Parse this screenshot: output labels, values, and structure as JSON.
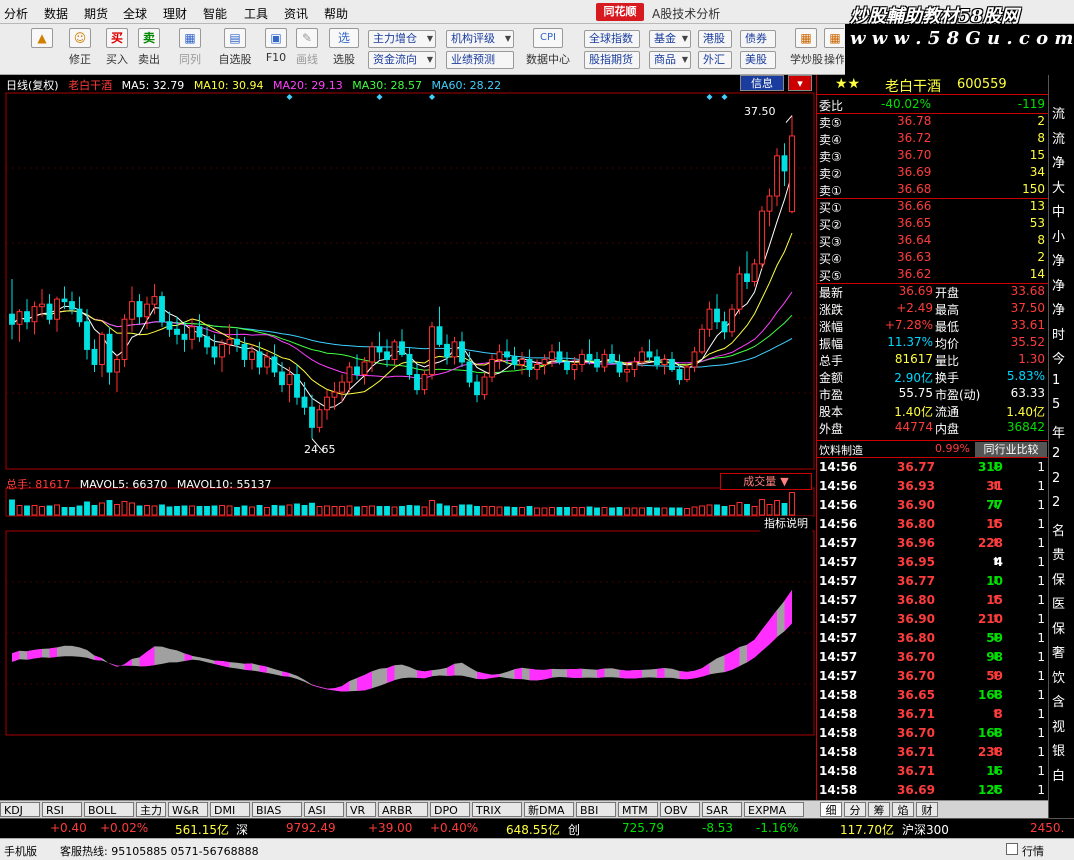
{
  "menu": [
    "分析",
    "数据",
    "期货",
    "全球",
    "理财",
    "智能",
    "工具",
    "资讯",
    "帮助"
  ],
  "brand": "同花顺",
  "app_title": "A股技术分析",
  "watermark": {
    "title": "炒股輔助教材58股网",
    "url": "w w w . 5 8 G u . c o m"
  },
  "toolbar": {
    "buttons": [
      {
        "label": "",
        "icon": "up-arrow-icon"
      },
      {
        "label": "修正",
        "icon": "face-icon"
      },
      {
        "label": "买入",
        "icon": "buy-icon"
      },
      {
        "label": "卖出",
        "icon": "sell-icon"
      },
      {
        "label": "同列",
        "icon": "columns-icon"
      },
      {
        "label": "自选股",
        "icon": "watchlist-icon"
      },
      {
        "label": "F10",
        "icon": "f10-icon"
      },
      {
        "label": "画线",
        "icon": "draw-line-icon"
      },
      {
        "label": "选股",
        "icon": "select-stock-icon"
      },
      {
        "label": "数据中心",
        "icon": "data-center-icon"
      },
      {
        "label": "学炒股",
        "icon": "learn-icon"
      },
      {
        "label": "操作分",
        "icon": "ops-icon"
      }
    ],
    "icon_text": {
      "buy": "买",
      "sell": "卖",
      "select": "选",
      "cpi": "CPI"
    },
    "pills": [
      "主力增仓",
      "资金流向",
      "机构评级",
      "业绩预测",
      "全球指数",
      "股指期货",
      "基金",
      "商品",
      "港股",
      "外汇",
      "债券",
      "美股"
    ]
  },
  "chart": {
    "period_label": "日线(复权)",
    "stock_name": "老白干酒",
    "ma": [
      {
        "label": "MA5: 32.79",
        "color": "#ffffff"
      },
      {
        "label": "MA10: 30.94",
        "color": "#ffff40"
      },
      {
        "label": "MA20: 29.13",
        "color": "#ff40ff"
      },
      {
        "label": "MA30: 28.57",
        "color": "#40ff40"
      },
      {
        "label": "MA60: 28.22",
        "color": "#40d0ff"
      }
    ],
    "high_label": "37.50",
    "low_label": "24.65",
    "info_btn": "信息",
    "vol_line": {
      "total_label": "总手:",
      "total": "81617",
      "mavol5": "MAVOL5: 66370",
      "mavol10": "MAVOL10: 55137"
    },
    "vol_btn": "成交量",
    "indicator_btn": "指标说明",
    "indicator_tabs": [
      "KDJ",
      "RSI",
      "BOLL",
      "主力",
      "W&R",
      "DMI",
      "BIAS",
      "ASI",
      "VR",
      "ARBR",
      "DPO",
      "TRIX",
      "新DMA",
      "BBI",
      "MTM",
      "OBV",
      "SAR",
      "EXPMA"
    ]
  },
  "quote": {
    "name": "老白干酒",
    "code": "600559",
    "weibi": {
      "label": "委比",
      "pct": "-40.02%",
      "diff": "-119"
    },
    "asks": [
      {
        "label": "卖⑤",
        "price": "36.78",
        "vol": "2"
      },
      {
        "label": "卖④",
        "price": "36.72",
        "vol": "8"
      },
      {
        "label": "卖③",
        "price": "36.70",
        "vol": "15"
      },
      {
        "label": "卖②",
        "price": "36.69",
        "vol": "34"
      },
      {
        "label": "卖①",
        "price": "36.68",
        "vol": "150"
      }
    ],
    "bids": [
      {
        "label": "买①",
        "price": "36.66",
        "vol": "13"
      },
      {
        "label": "买②",
        "price": "36.65",
        "vol": "53"
      },
      {
        "label": "买③",
        "price": "36.64",
        "vol": "8"
      },
      {
        "label": "买④",
        "price": "36.63",
        "vol": "2"
      },
      {
        "label": "买⑤",
        "price": "36.62",
        "vol": "14"
      }
    ],
    "stats": [
      {
        "l1": "最新",
        "v1": "36.69",
        "c1": "red",
        "l2": "开盘",
        "v2": "33.68",
        "c2": "red"
      },
      {
        "l1": "涨跌",
        "v1": "+2.49",
        "c1": "red",
        "l2": "最高",
        "v2": "37.50",
        "c2": "red"
      },
      {
        "l1": "涨幅",
        "v1": "+7.28%",
        "c1": "red",
        "l2": "最低",
        "v2": "33.61",
        "c2": "red"
      },
      {
        "l1": "振幅",
        "v1": "11.37%",
        "c1": "cyan",
        "l2": "均价",
        "v2": "35.52",
        "c2": "red"
      },
      {
        "l1": "总手",
        "v1": "81617",
        "c1": "yellow",
        "l2": "量比",
        "v2": "1.30",
        "c2": "red"
      },
      {
        "l1": "金额",
        "v1": "2.90亿",
        "c1": "cyan",
        "l2": "换手",
        "v2": "5.83%",
        "c2": "cyan"
      },
      {
        "l1": "市盈",
        "v1": "55.75",
        "c1": "white",
        "l2": "市盈(动)",
        "v2": "63.33",
        "c2": "white"
      },
      {
        "l1": "股本",
        "v1": "1.40亿",
        "c1": "yellow",
        "l2": "流通",
        "v2": "1.40亿",
        "c2": "yellow"
      },
      {
        "l1": "外盘",
        "v1": "44774",
        "c1": "red",
        "l2": "内盘",
        "v2": "36842",
        "c2": "green"
      }
    ],
    "industry": {
      "name": "饮料制造",
      "pct": "0.99%",
      "btn": "同行业比较"
    },
    "ticks": [
      {
        "t": "14:56",
        "p": "36.77",
        "v": "319",
        "d": "down",
        "n": "1"
      },
      {
        "t": "14:56",
        "p": "36.93",
        "v": "31",
        "d": "up",
        "n": "1"
      },
      {
        "t": "14:56",
        "p": "36.90",
        "v": "77",
        "d": "down",
        "n": "1"
      },
      {
        "t": "14:56",
        "p": "36.80",
        "v": "15",
        "d": "up",
        "n": "1"
      },
      {
        "t": "14:57",
        "p": "36.96",
        "v": "228",
        "d": "up",
        "n": "1"
      },
      {
        "t": "14:57",
        "p": "36.95",
        "v": "4",
        "d": "flat",
        "n": "1"
      },
      {
        "t": "14:57",
        "p": "36.77",
        "v": "10",
        "d": "down",
        "n": "1"
      },
      {
        "t": "14:57",
        "p": "36.80",
        "v": "15",
        "d": "up",
        "n": "1"
      },
      {
        "t": "14:57",
        "p": "36.90",
        "v": "210",
        "d": "up",
        "n": "1"
      },
      {
        "t": "14:57",
        "p": "36.80",
        "v": "59",
        "d": "down",
        "n": "1"
      },
      {
        "t": "14:57",
        "p": "36.70",
        "v": "98",
        "d": "down",
        "n": "1"
      },
      {
        "t": "14:57",
        "p": "36.70",
        "v": "59",
        "d": "up",
        "n": "1"
      },
      {
        "t": "14:58",
        "p": "36.65",
        "v": "163",
        "d": "down",
        "n": "1"
      },
      {
        "t": "14:58",
        "p": "36.71",
        "v": "3",
        "d": "up",
        "n": "1"
      },
      {
        "t": "14:58",
        "p": "36.70",
        "v": "163",
        "d": "down",
        "n": "1"
      },
      {
        "t": "14:58",
        "p": "36.71",
        "v": "238",
        "d": "up",
        "n": "1"
      },
      {
        "t": "14:58",
        "p": "36.71",
        "v": "16",
        "d": "down",
        "n": "1"
      },
      {
        "t": "14:58",
        "p": "36.69",
        "v": "125",
        "d": "down",
        "n": "1"
      }
    ],
    "tabs": [
      "细",
      "分",
      "筹",
      "焰",
      "财"
    ]
  },
  "far_right": [
    "流",
    "流",
    "净",
    "大",
    "中",
    "小",
    "净",
    "净",
    "净",
    "时",
    "今",
    "1",
    "5",
    "年",
    "2",
    "2",
    "2",
    "名",
    "贵",
    "保",
    "医",
    "保",
    "奢",
    "饮",
    "含",
    "视",
    "银",
    "白"
  ],
  "status": {
    "idx1_change": "+0.40",
    "idx1_pct": "+0.02%",
    "idx1_amt": "561.15亿",
    "idx2_name": "深",
    "idx2_val": "9792.49",
    "idx2_change": "+39.00",
    "idx2_pct": "+0.40%",
    "idx2_amt": "648.55亿",
    "idx3_name": "创",
    "idx3_val": "725.79",
    "idx3_change": "-8.53",
    "idx3_pct": "-1.16%",
    "idx4_amt": "117.70亿",
    "idx4_name": "沪深300",
    "idx4_val": "2450."
  },
  "bottom": {
    "left": "手机版",
    "hotline": "客服热线: 95105885 0571-56768888",
    "right": "行情"
  },
  "chart_data": {
    "type": "candlestick",
    "title": "",
    "period": "daily",
    "price_labels": {
      "high": "37.50",
      "low": "24.65"
    },
    "candles": [
      [
        29.6,
        31.0,
        28.6,
        29.2
      ],
      [
        29.2,
        29.8,
        28.5,
        29.7
      ],
      [
        29.7,
        30.2,
        29.0,
        29.3
      ],
      [
        29.3,
        30.1,
        28.8,
        29.9
      ],
      [
        29.9,
        30.6,
        29.5,
        30.0
      ],
      [
        30.0,
        30.4,
        29.2,
        29.4
      ],
      [
        29.4,
        30.3,
        28.9,
        30.2
      ],
      [
        30.2,
        30.7,
        29.8,
        30.1
      ],
      [
        30.1,
        30.5,
        29.6,
        29.8
      ],
      [
        29.8,
        30.3,
        29.1,
        29.3
      ],
      [
        29.3,
        29.8,
        27.8,
        28.2
      ],
      [
        28.2,
        28.6,
        27.3,
        27.6
      ],
      [
        27.6,
        28.9,
        27.1,
        28.8
      ],
      [
        28.8,
        29.1,
        26.8,
        27.3
      ],
      [
        27.3,
        28.0,
        26.5,
        27.8
      ],
      [
        27.8,
        29.6,
        27.5,
        29.4
      ],
      [
        29.4,
        30.7,
        28.9,
        30.1
      ],
      [
        30.1,
        30.4,
        29.2,
        29.5
      ],
      [
        29.5,
        30.3,
        29.0,
        30.0
      ],
      [
        30.0,
        30.8,
        29.6,
        30.3
      ],
      [
        30.3,
        30.5,
        29.1,
        29.3
      ],
      [
        29.3,
        29.7,
        28.7,
        29.0
      ],
      [
        29.0,
        29.5,
        28.4,
        28.8
      ],
      [
        28.8,
        29.3,
        28.1,
        28.6
      ],
      [
        28.6,
        29.4,
        28.2,
        29.1
      ],
      [
        29.1,
        29.6,
        28.5,
        28.7
      ],
      [
        28.7,
        29.1,
        28.0,
        28.3
      ],
      [
        28.3,
        28.8,
        27.6,
        27.9
      ],
      [
        27.9,
        28.6,
        27.3,
        28.4
      ],
      [
        28.4,
        29.2,
        28.0,
        28.6
      ],
      [
        28.6,
        29.0,
        28.1,
        28.4
      ],
      [
        28.4,
        28.7,
        27.5,
        27.8
      ],
      [
        27.8,
        28.4,
        27.4,
        28.1
      ],
      [
        28.1,
        28.5,
        27.2,
        27.5
      ],
      [
        27.5,
        28.1,
        27.2,
        27.9
      ],
      [
        27.9,
        28.4,
        27.1,
        27.3
      ],
      [
        27.3,
        27.7,
        26.5,
        26.8
      ],
      [
        26.8,
        27.5,
        26.1,
        27.2
      ],
      [
        27.2,
        27.6,
        26.0,
        26.3
      ],
      [
        26.3,
        26.9,
        25.6,
        25.9
      ],
      [
        25.9,
        26.4,
        24.65,
        25.1
      ],
      [
        25.1,
        26.0,
        24.9,
        25.8
      ],
      [
        25.8,
        26.6,
        25.4,
        26.3
      ],
      [
        26.3,
        26.9,
        25.8,
        26.5
      ],
      [
        26.5,
        27.2,
        26.1,
        26.9
      ],
      [
        26.9,
        27.7,
        26.5,
        27.5
      ],
      [
        27.5,
        28.0,
        27.0,
        27.2
      ],
      [
        27.2,
        27.9,
        26.8,
        27.7
      ],
      [
        27.7,
        28.5,
        27.3,
        28.3
      ],
      [
        28.3,
        28.9,
        27.8,
        28.1
      ],
      [
        28.1,
        28.6,
        27.5,
        27.8
      ],
      [
        27.8,
        28.6,
        27.6,
        28.5
      ],
      [
        28.5,
        29.0,
        27.9,
        28.0
      ],
      [
        28.0,
        28.3,
        27.0,
        27.2
      ],
      [
        27.2,
        27.6,
        26.4,
        26.6
      ],
      [
        26.6,
        27.4,
        26.4,
        27.2
      ],
      [
        27.2,
        29.3,
        27.0,
        29.1
      ],
      [
        29.1,
        29.9,
        28.3,
        28.4
      ],
      [
        28.4,
        28.8,
        27.6,
        27.9
      ],
      [
        27.9,
        28.7,
        27.6,
        28.5
      ],
      [
        28.5,
        28.9,
        27.5,
        27.7
      ],
      [
        27.7,
        28.1,
        26.7,
        26.9
      ],
      [
        26.9,
        27.2,
        26.1,
        26.4
      ],
      [
        26.4,
        27.3,
        26.2,
        27.1
      ],
      [
        27.1,
        28.0,
        26.9,
        27.8
      ],
      [
        27.8,
        28.4,
        27.4,
        28.1
      ],
      [
        28.1,
        28.6,
        27.6,
        27.9
      ],
      [
        27.9,
        28.3,
        27.4,
        27.6
      ],
      [
        27.6,
        28.1,
        27.2,
        27.8
      ],
      [
        27.8,
        28.2,
        27.1,
        27.4
      ],
      [
        27.4,
        27.8,
        27.0,
        27.6
      ],
      [
        27.6,
        28.0,
        27.2,
        27.8
      ],
      [
        27.8,
        28.4,
        27.5,
        28.1
      ],
      [
        28.1,
        28.5,
        27.6,
        27.7
      ],
      [
        27.7,
        28.1,
        27.2,
        27.4
      ],
      [
        27.4,
        27.9,
        27.0,
        27.6
      ],
      [
        27.6,
        28.2,
        27.3,
        28.0
      ],
      [
        28.0,
        28.6,
        27.6,
        27.8
      ],
      [
        27.8,
        28.1,
        27.3,
        27.5
      ],
      [
        27.5,
        28.2,
        27.3,
        28.0
      ],
      [
        28.0,
        28.4,
        27.6,
        27.7
      ],
      [
        27.7,
        28.0,
        27.1,
        27.3
      ],
      [
        27.3,
        27.7,
        26.9,
        27.4
      ],
      [
        27.4,
        27.9,
        27.1,
        27.7
      ],
      [
        27.7,
        28.3,
        27.5,
        28.1
      ],
      [
        28.1,
        28.6,
        27.7,
        27.9
      ],
      [
        27.9,
        28.2,
        27.4,
        27.6
      ],
      [
        27.6,
        28.0,
        27.2,
        27.8
      ],
      [
        27.8,
        28.1,
        27.3,
        27.4
      ],
      [
        27.4,
        27.6,
        26.8,
        27.0
      ],
      [
        27.0,
        27.6,
        26.9,
        27.5
      ],
      [
        27.5,
        28.3,
        27.3,
        28.1
      ],
      [
        28.1,
        29.2,
        28.0,
        29.0
      ],
      [
        29.0,
        30.1,
        28.7,
        29.8
      ],
      [
        29.8,
        30.4,
        29.0,
        29.3
      ],
      [
        29.3,
        29.7,
        28.6,
        28.9
      ],
      [
        28.9,
        30.0,
        28.7,
        29.8
      ],
      [
        29.8,
        31.5,
        29.6,
        31.2
      ],
      [
        31.2,
        32.1,
        30.6,
        30.9
      ],
      [
        30.9,
        31.8,
        30.7,
        31.6
      ],
      [
        31.6,
        33.9,
        31.4,
        33.7
      ],
      [
        33.7,
        34.6,
        33.1,
        34.3
      ],
      [
        34.3,
        36.2,
        33.9,
        35.9
      ],
      [
        35.9,
        36.4,
        34.7,
        35.3
      ],
      [
        33.68,
        37.5,
        33.61,
        36.69
      ]
    ],
    "ma": {
      "MA5": 32.79,
      "MA10": 30.94,
      "MA20": 29.13,
      "MA30": 28.57,
      "MA60": 28.22
    },
    "volume": {
      "last": 81617,
      "MAVOL5": 66370,
      "MAVOL10": 55137
    }
  }
}
